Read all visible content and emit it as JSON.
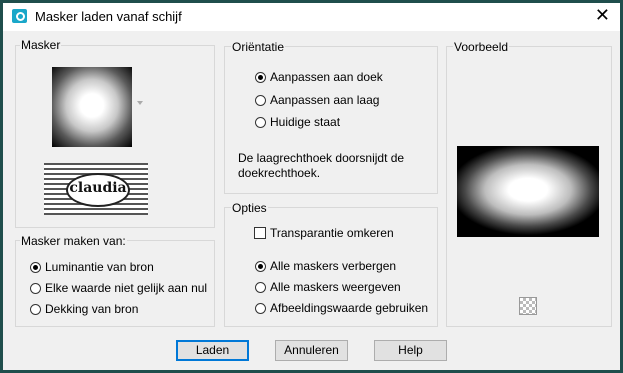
{
  "window": {
    "title": "Masker laden vanaf schijf",
    "close": "✕"
  },
  "masker": {
    "label": "Masker",
    "logo_text": "claudia"
  },
  "source": {
    "label": "Masker maken van:",
    "options": [
      "Luminantie van bron",
      "Elke waarde niet gelijk aan nul",
      "Dekking van bron"
    ],
    "selected": 0
  },
  "orientation": {
    "label": "Oriëntatie",
    "options": [
      "Aanpassen aan doek",
      "Aanpassen aan laag",
      "Huidige staat"
    ],
    "selected": 0,
    "info": "De laagrechthoek doorsnijdt de doekrechthoek."
  },
  "options": {
    "label": "Opties",
    "invert_label": "Transparantie omkeren",
    "invert_checked": false,
    "mask_options": [
      "Alle maskers verbergen",
      "Alle maskers weergeven",
      "Afbeeldingswaarde gebruiken"
    ],
    "selected": 0
  },
  "preview": {
    "label": "Voorbeeld"
  },
  "buttons": {
    "load": "Laden",
    "cancel": "Annuleren",
    "help": "Help"
  },
  "icons": [
    "app-icon",
    "close-icon",
    "chevron-down-icon",
    "transparency-icon"
  ]
}
